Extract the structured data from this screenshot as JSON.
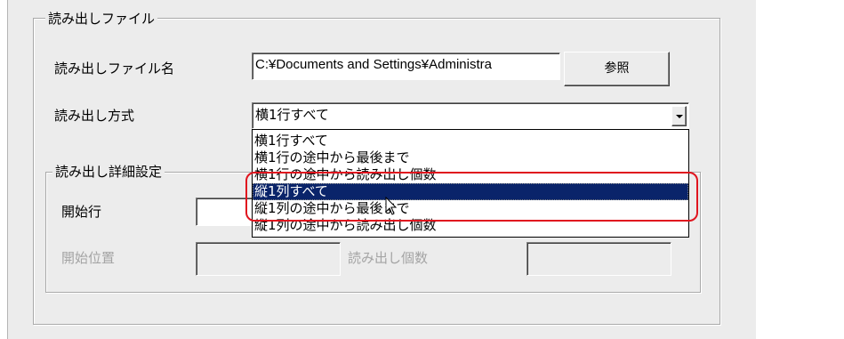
{
  "file_group": {
    "title": "読み出しファイル",
    "filename_label": "読み出しファイル名",
    "filename_value": "C:¥Documents and Settings¥Administra",
    "browse_label": "参照",
    "method_label": "読み出し方式",
    "method_value": "横1行すべて",
    "method_options": [
      "横1行すべて",
      "横1行の途中から最後まで",
      "横1行の途中から読み出し個数",
      "縦1列すべて",
      "縦1列の途中から最後まで",
      "縦1列の途中から読み出し個数"
    ],
    "selected_option": "縦1列すべて"
  },
  "detail_group": {
    "title": "読み出し詳細設定",
    "start_row_label": "開始行",
    "start_position_label": "開始位置",
    "read_count_label": "読み出し個数"
  },
  "colors": {
    "panel_bg": "#ececec",
    "selection_bg": "#0a246a",
    "annotation_ring": "#e0141e"
  }
}
